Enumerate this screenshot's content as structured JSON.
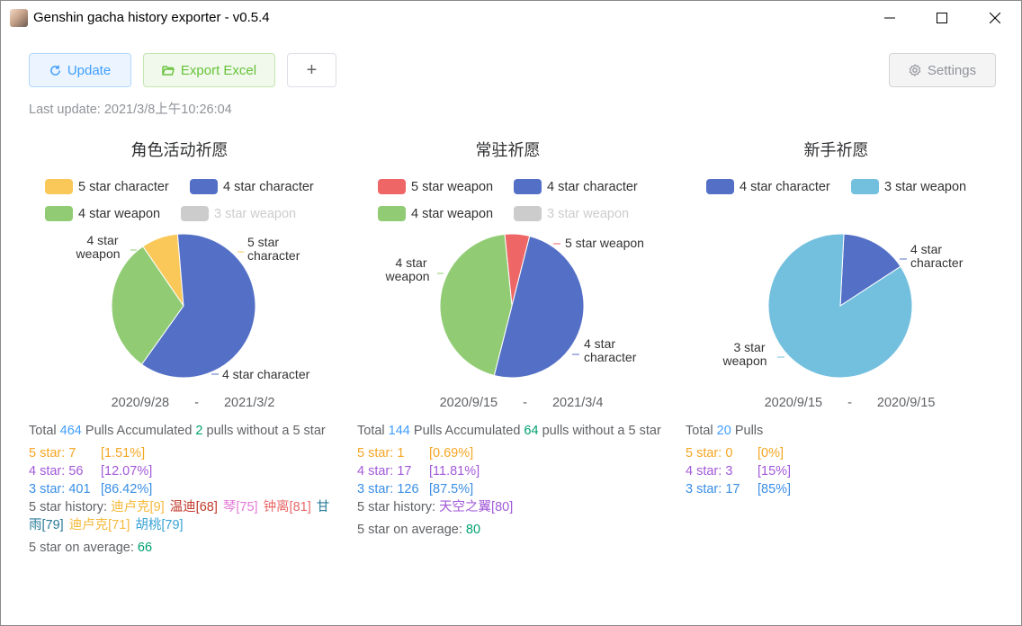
{
  "app": {
    "title": "Genshin gacha history exporter - v0.5.4"
  },
  "toolbar": {
    "update_label": "Update",
    "export_label": "Export Excel",
    "add_label": "+",
    "settings_label": "Settings"
  },
  "last_update": "Last update: 2021/3/8上午10:26:04",
  "colors": {
    "five_char": "#fac858",
    "four_char": "#5470c6",
    "four_weapon": "#91cc75",
    "three_weapon": "#73c0de",
    "five_weapon": "#ee6666",
    "disabled": "#cccccc"
  },
  "pools": [
    {
      "title": "角色活动祈愿",
      "legend": [
        {
          "label": "5 star character",
          "color": "#fac858",
          "enabled": true
        },
        {
          "label": "4 star character",
          "color": "#5470c6",
          "enabled": true
        },
        {
          "label": "4 star weapon",
          "color": "#91cc75",
          "enabled": true
        },
        {
          "label": "3 star weapon",
          "color": "#cccccc",
          "enabled": false
        }
      ],
      "start_date": "2020/9/28",
      "dash": "-",
      "end_date": "2021/3/2",
      "total": {
        "prefix": "Total ",
        "count": "464",
        "mid": " Pulls Accumulated ",
        "since": "2",
        "suffix": " pulls without a 5 star"
      },
      "lines": [
        {
          "label": "5 star: 7",
          "pct": "[1.51%]"
        },
        {
          "label": "4 star: 56",
          "pct": "[12.07%]"
        },
        {
          "label": "3 star: 401",
          "pct": "[86.42%]"
        }
      ],
      "history_label": "5 star history: ",
      "history": [
        {
          "text": "迪卢克[9]",
          "color": "#f5b93b"
        },
        {
          "text": "温迪[68]",
          "color": "#c0392b"
        },
        {
          "text": "琴[75]",
          "color": "#e27ad6"
        },
        {
          "text": "钟离[81]",
          "color": "#e86868"
        },
        {
          "text": "甘雨[79]",
          "color": "#2a7a98"
        },
        {
          "text": "迪卢克[71]",
          "color": "#f5b93b"
        },
        {
          "text": "胡桃[79]",
          "color": "#3ba3d6"
        }
      ],
      "avg_label": "5 star on average: ",
      "avg": "66",
      "chart_data": {
        "type": "pie",
        "series": [
          {
            "name": "5 star character",
            "value": 7,
            "label": "5 star character"
          },
          {
            "name": "4 star character",
            "value": 52,
            "label": "4 star character"
          },
          {
            "name": "4 star weapon",
            "value": 26,
            "label": "4 star weapon"
          }
        ]
      }
    },
    {
      "title": "常驻祈愿",
      "legend": [
        {
          "label": "5 star weapon",
          "color": "#ee6666",
          "enabled": true
        },
        {
          "label": "4 star character",
          "color": "#5470c6",
          "enabled": true
        },
        {
          "label": "4 star weapon",
          "color": "#91cc75",
          "enabled": true
        },
        {
          "label": "3 star weapon",
          "color": "#cccccc",
          "enabled": false
        }
      ],
      "start_date": "2020/9/15",
      "dash": "-",
      "end_date": "2021/3/4",
      "total": {
        "prefix": "Total ",
        "count": "144",
        "mid": " Pulls Accumulated ",
        "since": "64",
        "suffix": " pulls without a 5 star"
      },
      "lines": [
        {
          "label": "5 star: 1",
          "pct": "[0.69%]"
        },
        {
          "label": "4 star: 17",
          "pct": "[11.81%]"
        },
        {
          "label": "3 star: 126",
          "pct": "[87.5%]"
        }
      ],
      "history_label": "5 star history: ",
      "history": [
        {
          "text": "天空之翼[80]",
          "color": "#a259d9"
        }
      ],
      "avg_label": "5 star on average: ",
      "avg": "80",
      "chart_data": {
        "type": "pie",
        "series": [
          {
            "name": "5 star weapon",
            "value": 1,
            "label": "5 star weapon"
          },
          {
            "name": "4 star character",
            "value": 9,
            "label": "4 star character"
          },
          {
            "name": "4 star weapon",
            "value": 8,
            "label": "4 star weapon"
          }
        ]
      }
    },
    {
      "title": "新手祈愿",
      "legend": [
        {
          "label": "4 star character",
          "color": "#5470c6",
          "enabled": true
        },
        {
          "label": "3 star weapon",
          "color": "#73c0de",
          "enabled": true
        }
      ],
      "start_date": "2020/9/15",
      "dash": "-",
      "end_date": "2020/9/15",
      "total": {
        "prefix": "Total ",
        "count": "20",
        "mid": " Pulls",
        "since": "",
        "suffix": ""
      },
      "lines": [
        {
          "label": "5 star: 0",
          "pct": "[0%]"
        },
        {
          "label": "4 star: 3",
          "pct": "[15%]"
        },
        {
          "label": "3 star: 17",
          "pct": "[85%]"
        }
      ],
      "history_label": "",
      "history": [],
      "avg_label": "",
      "avg": "",
      "chart_data": {
        "type": "pie",
        "series": [
          {
            "name": "4 star character",
            "value": 3,
            "label": "4 star character"
          },
          {
            "name": "3 star weapon",
            "value": 17,
            "label": "3 star weapon"
          }
        ]
      }
    }
  ]
}
